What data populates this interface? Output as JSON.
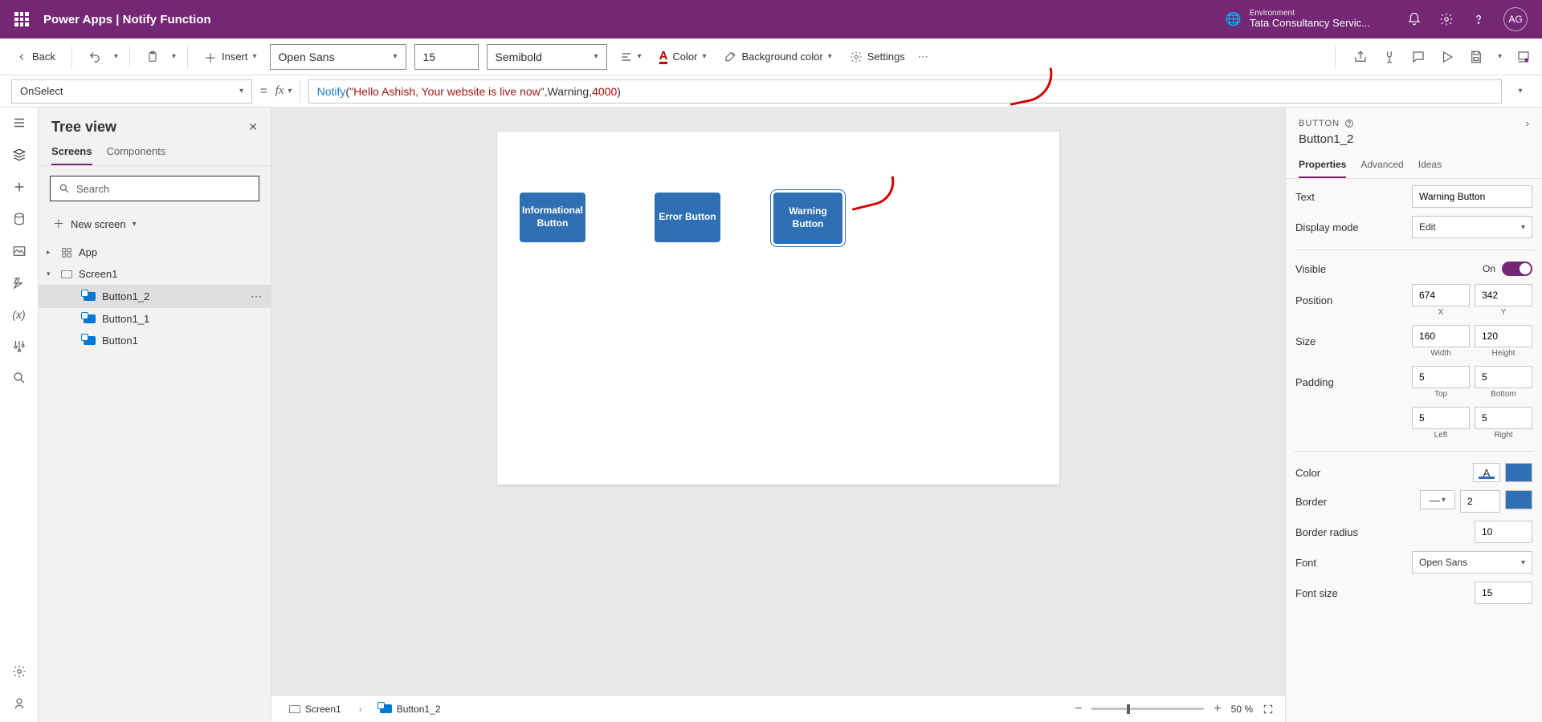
{
  "topbar": {
    "app_title": "Power Apps  |  Notify Function",
    "env_label": "Environment",
    "env_value": "Tata Consultancy Servic...",
    "avatar": "AG"
  },
  "ribbon": {
    "back": "Back",
    "insert": "Insert",
    "font": "Open Sans",
    "font_size": "15",
    "font_weight": "Semibold",
    "color": "Color",
    "bgcolor": "Background color",
    "settings": "Settings"
  },
  "formula": {
    "property": "OnSelect",
    "func": "Notify",
    "str": "\"Hello Ashish, Your website is live now\"",
    "arg2": "Warning",
    "num": "4000"
  },
  "tree": {
    "title": "Tree view",
    "tabs": {
      "screens": "Screens",
      "components": "Components"
    },
    "search_placeholder": "Search",
    "new_screen": "New screen",
    "app": "App",
    "screen": "Screen1",
    "btn12": "Button1_2",
    "btn11": "Button1_1",
    "btn1": "Button1"
  },
  "canvas": {
    "info": "Informational Button",
    "error": "Error Button",
    "warning": "Warning Button"
  },
  "status": {
    "screen": "Screen1",
    "sel": "Button1_2",
    "zoom": "50  %"
  },
  "props": {
    "type": "BUTTON",
    "name": "Button1_2",
    "tabs": {
      "properties": "Properties",
      "advanced": "Advanced",
      "ideas": "Ideas"
    },
    "text_label": "Text",
    "text_val": "Warning Button",
    "mode_label": "Display mode",
    "mode_val": "Edit",
    "visible_label": "Visible",
    "visible_on": "On",
    "position_label": "Position",
    "x": "674",
    "y": "342",
    "xlab": "X",
    "ylab": "Y",
    "size_label": "Size",
    "w": "160",
    "h": "120",
    "wlab": "Width",
    "hlab": "Height",
    "padding_label": "Padding",
    "pt": "5",
    "pb": "5",
    "pl": "5",
    "pr": "5",
    "ptlab": "Top",
    "pblab": "Bottom",
    "pllab": "Left",
    "prlab": "Right",
    "color_label": "Color",
    "border_label": "Border",
    "border_w": "2",
    "radius_label": "Border radius",
    "radius": "10",
    "font_label": "Font",
    "font_val": "Open Sans",
    "fsize_label": "Font size",
    "fsize": "15"
  }
}
